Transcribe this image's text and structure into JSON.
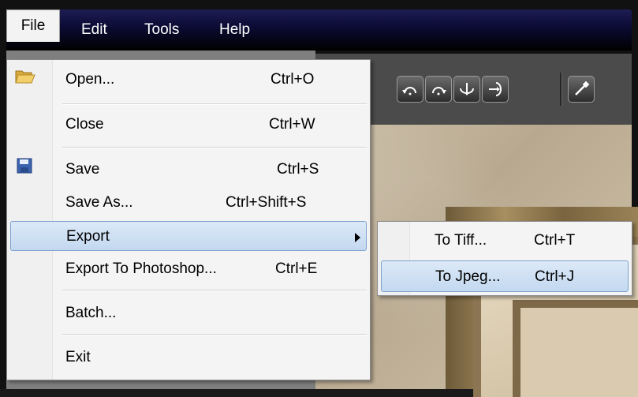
{
  "menubar": {
    "items": [
      {
        "label": "File"
      },
      {
        "label": "Edit"
      },
      {
        "label": "Tools"
      },
      {
        "label": "Help"
      }
    ]
  },
  "file_menu": {
    "items": [
      {
        "label": "Open...",
        "shortcut": "Ctrl+O",
        "icon": "folder-open-icon"
      },
      {
        "label": "Close",
        "shortcut": "Ctrl+W"
      },
      {
        "label": "Save",
        "shortcut": "Ctrl+S",
        "icon": "floppy-disk-icon"
      },
      {
        "label": "Save As...",
        "shortcut": "Ctrl+Shift+S"
      },
      {
        "label": "Export",
        "shortcut": ""
      },
      {
        "label": "Export To Photoshop...",
        "shortcut": "Ctrl+E"
      },
      {
        "label": "Batch...",
        "shortcut": ""
      },
      {
        "label": "Exit",
        "shortcut": ""
      }
    ]
  },
  "export_submenu": {
    "items": [
      {
        "label": "To Tiff...",
        "shortcut": "Ctrl+T"
      },
      {
        "label": "To Jpeg...",
        "shortcut": "Ctrl+J"
      }
    ]
  },
  "toolbar": {
    "icons": [
      "rotate-left-icon",
      "rotate-right-icon",
      "flip-vertical-icon",
      "flip-horizontal-icon",
      "eyedropper-icon"
    ]
  },
  "colors": {
    "highlight": "#c9dcf2",
    "highlight_border": "#7da2ce",
    "menubar": "#000000"
  }
}
